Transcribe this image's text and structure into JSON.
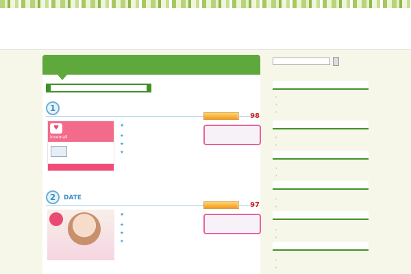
{
  "site": {
    "title": "",
    "subtitle": "",
    "header_right": ""
  },
  "page": {
    "title": ""
  },
  "notice": {
    "text_before": "",
    "link": "",
    "text_after": ""
  },
  "ranks": [
    {
      "num": "1",
      "name": "",
      "banner": {
        "logo_text": "lovemall",
        "head1": "",
        "head2": "",
        "mid_text": "",
        "bottom": ""
      },
      "point_label": "",
      "points": [
        "",
        "",
        ""
      ],
      "score_label": "",
      "score": 98,
      "score_text": "98",
      "cta": ""
    },
    {
      "num": "2",
      "name": "DATE",
      "banner": {
        "badge": "",
        "tag": "",
        "logo": ""
      },
      "point_label": "",
      "points": [
        "",
        "",
        ""
      ],
      "score_label": "",
      "score": 97,
      "score_text": "97",
      "cta": ""
    }
  ],
  "sidebar": {
    "widgets": [
      {
        "title": "",
        "items": [
          "",
          "",
          ""
        ]
      },
      {
        "title": "",
        "items": [
          "",
          ""
        ]
      },
      {
        "title": "",
        "items": [
          "",
          ""
        ]
      },
      {
        "title": "",
        "items": [
          "",
          ""
        ]
      },
      {
        "title": "",
        "items": [
          "",
          ""
        ]
      },
      {
        "title": "",
        "items": [
          "",
          ""
        ]
      }
    ]
  },
  "icons": {
    "star": "star-icon",
    "arrow": "arrow-right-icon",
    "heart": "heart-icon",
    "mail": "mail-icon"
  },
  "colors": {
    "accent_green": "#5fa83c",
    "rank_blue": "#3b8fc4",
    "score_red": "#cc2222",
    "cta_pink": "#e8629a"
  }
}
